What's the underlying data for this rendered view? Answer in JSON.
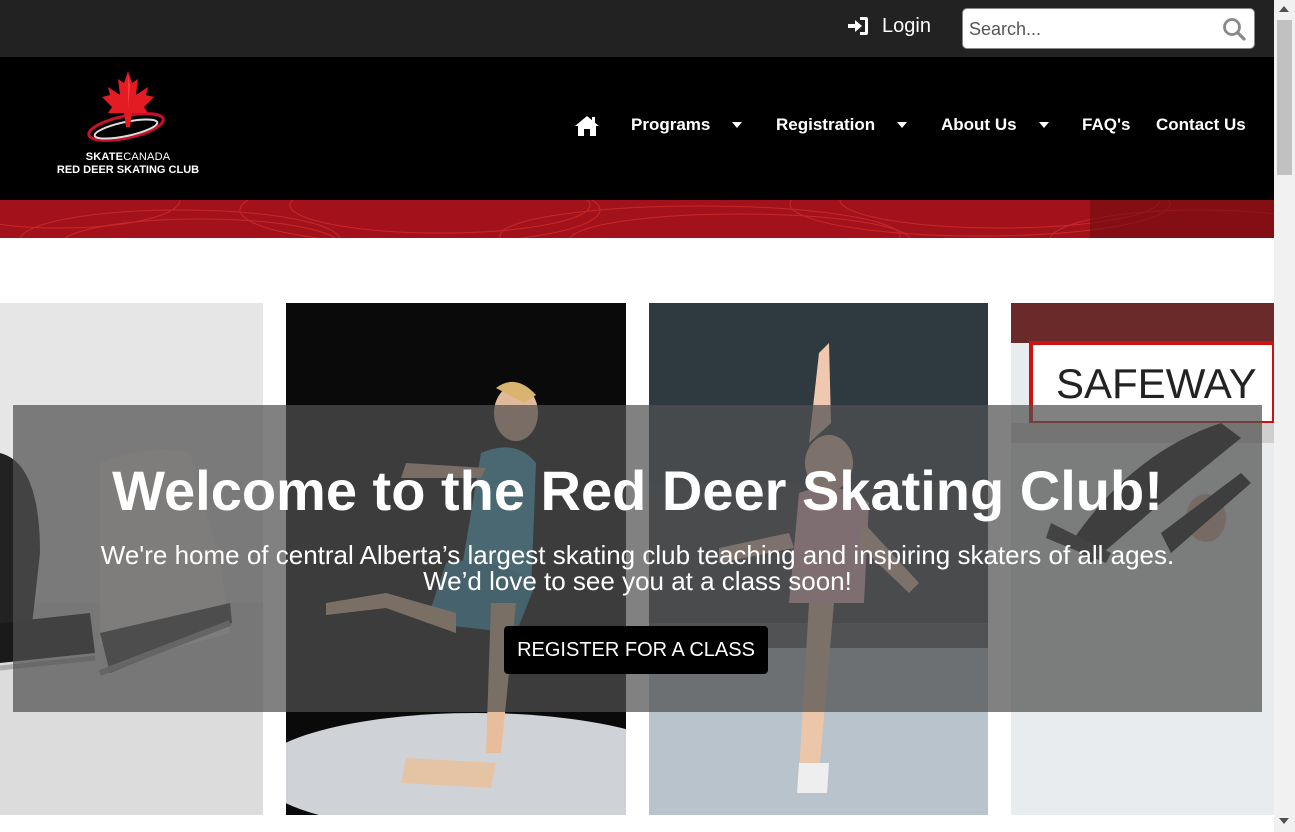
{
  "topbar": {
    "login_label": "Login",
    "login_icon": "sign-in-icon",
    "search_placeholder": "Search...",
    "search_icon": "search-icon"
  },
  "logo": {
    "line1_bold": "SKATE",
    "line1_rest": "CANADA",
    "line2": "RED DEER SKATING CLUB"
  },
  "nav": {
    "home_icon": "home-icon",
    "items": [
      {
        "label": "Programs",
        "dropdown": true
      },
      {
        "label": "Registration",
        "dropdown": true
      },
      {
        "label": "About Us",
        "dropdown": true
      },
      {
        "label": "FAQ's",
        "dropdown": false
      },
      {
        "label": "Contact Us",
        "dropdown": false
      }
    ]
  },
  "hero": {
    "title": "Welcome to the Red Deer Skating Club!",
    "subtitle_line1": "We're home of central Alberta’s largest skating club teaching and inspiring skaters of all ages.",
    "subtitle_line2": "We’d love to see you at a class soon!",
    "button_label": "REGISTER FOR A CLASS",
    "photo4_sign": "SAFEWAY"
  },
  "colors": {
    "topbar_bg": "#222222",
    "nav_bg": "#000000",
    "banner_red": "#9c1015",
    "overlay": "rgba(80,80,80,0.72)"
  }
}
